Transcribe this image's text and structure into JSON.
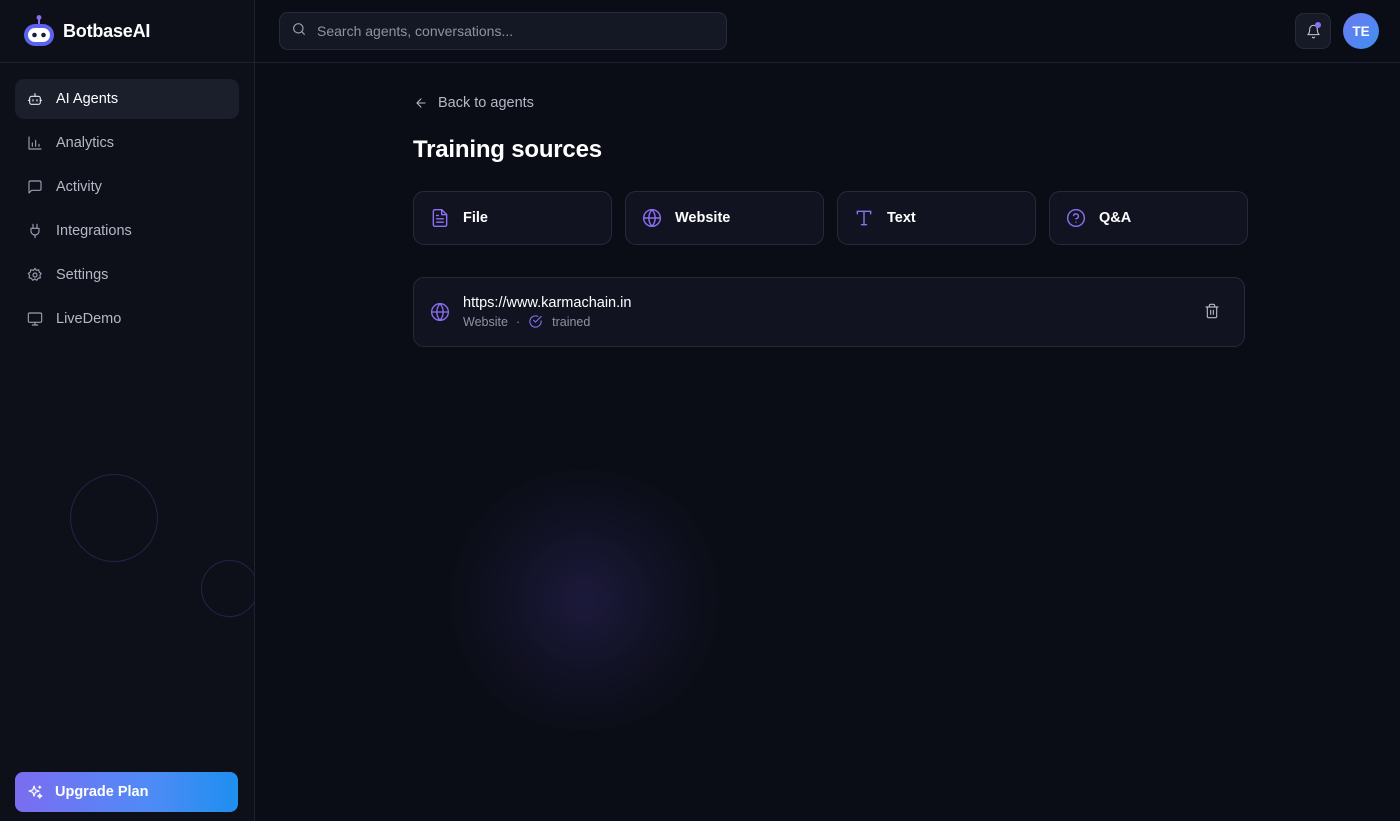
{
  "brand": {
    "name": "BotbaseAI",
    "logo_icon": "robot-icon"
  },
  "colors": {
    "accent": "#8b6ff5",
    "background": "#0b0d16",
    "upgrade_start": "#7b6df0",
    "upgrade_end": "#1e8ff0"
  },
  "sidebar": {
    "items": [
      {
        "label": "AI Agents",
        "icon": "bot-icon",
        "active": true
      },
      {
        "label": "Analytics",
        "icon": "bar-chart-icon",
        "active": false
      },
      {
        "label": "Activity",
        "icon": "message-icon",
        "active": false
      },
      {
        "label": "Integrations",
        "icon": "plug-icon",
        "active": false
      },
      {
        "label": "Settings",
        "icon": "gear-icon",
        "active": false
      },
      {
        "label": "LiveDemo",
        "icon": "monitor-icon",
        "active": false
      }
    ],
    "upgrade_label": "Upgrade Plan"
  },
  "topbar": {
    "search_placeholder": "Search agents, conversations...",
    "search_value": "",
    "avatar_initials": "TE"
  },
  "main": {
    "back_label": "Back to agents",
    "title": "Training sources",
    "source_types": [
      {
        "label": "File",
        "icon": "file-text-icon"
      },
      {
        "label": "Website",
        "icon": "globe-icon"
      },
      {
        "label": "Text",
        "icon": "text-type-icon"
      },
      {
        "label": "Q&A",
        "icon": "help-circle-icon"
      }
    ],
    "sources": [
      {
        "url": "https://www.karmachain.in",
        "type": "Website",
        "separator": "·",
        "status": "trained"
      }
    ]
  }
}
